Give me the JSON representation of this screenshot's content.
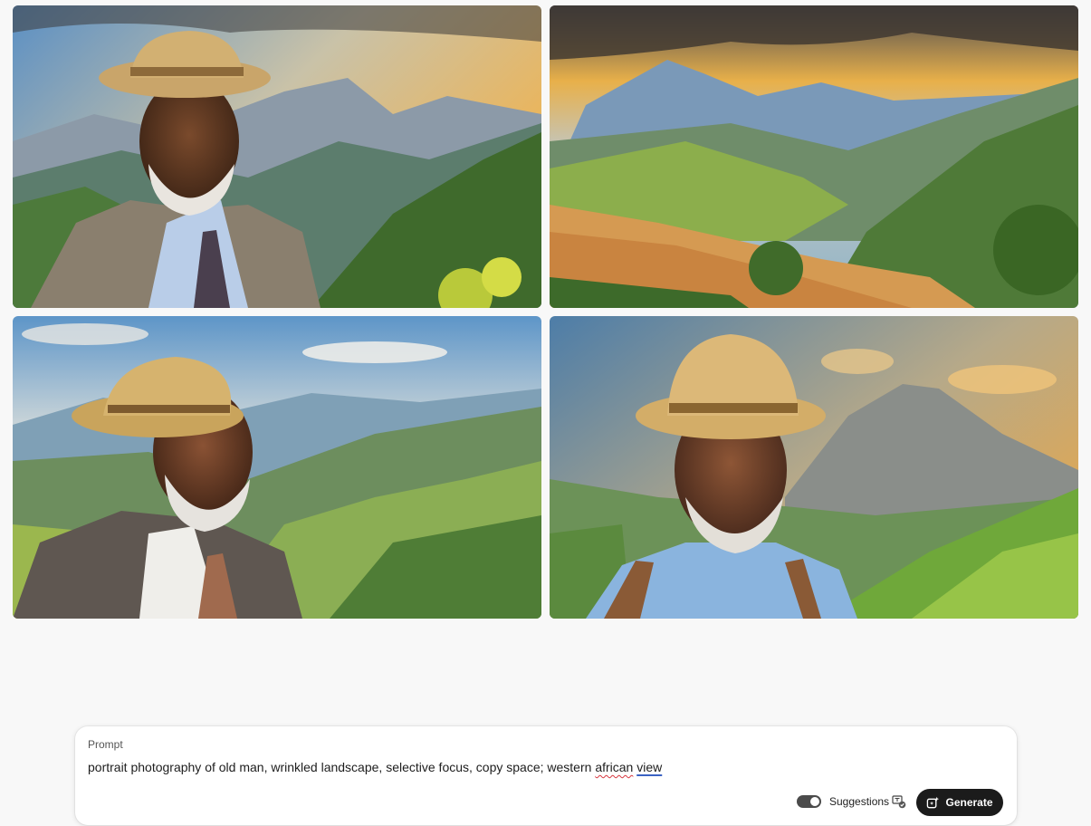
{
  "images": [
    {
      "alt": "generated-image-1"
    },
    {
      "alt": "generated-image-2"
    },
    {
      "alt": "generated-image-3"
    },
    {
      "alt": "generated-image-4"
    }
  ],
  "prompt": {
    "label": "Prompt",
    "text_before": "portrait photography of old man, wrinkled landscape, selective focus, copy space; western ",
    "misspelled_word": "african",
    "space": " ",
    "suggested_word": "view"
  },
  "controls": {
    "suggestions_label": "Suggestions",
    "suggestions_enabled": true,
    "generate_label": "Generate"
  },
  "icons": {
    "suggestions": "translate-check-icon",
    "generate": "sparkle-generate-icon"
  },
  "colors": {
    "generate_bg": "#1b1b1b",
    "toggle_on": "#4b4b4b",
    "misspell_underline": "#d7373f",
    "suggestion_underline": "#3b63c4"
  }
}
